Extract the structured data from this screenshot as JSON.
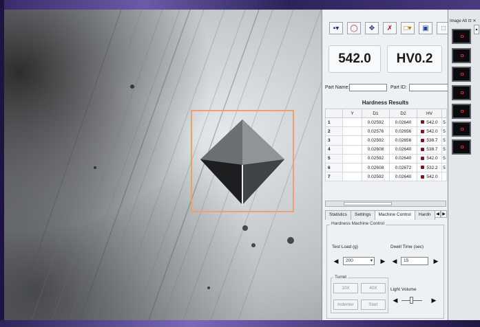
{
  "toolbar": {
    "icons": [
      "camera-icon",
      "target-icon",
      "crosshair-move-icon",
      "delete-icon",
      "open-folder-icon",
      "save-icon",
      "window-icon"
    ]
  },
  "readouts": {
    "hardness_value": "542.0",
    "scale": "HV0.2"
  },
  "part": {
    "name_label": "Part Name:",
    "id_label": "Part ID:",
    "name_value": "",
    "id_value": ""
  },
  "results": {
    "title": "Hardness Results",
    "columns": [
      "",
      "Y",
      "D1",
      "D2",
      "HV",
      ""
    ],
    "rows": [
      {
        "n": "1",
        "y": "",
        "d1": "0.02592",
        "d2": "0.02640",
        "hv": "542.0",
        "extra": "5"
      },
      {
        "n": "2",
        "y": "",
        "d1": "0.02576",
        "d2": "0.02656",
        "hv": "542.0",
        "extra": "5"
      },
      {
        "n": "3",
        "y": "",
        "d1": "0.02592",
        "d2": "0.02656",
        "hv": "538.7",
        "extra": "5"
      },
      {
        "n": "4",
        "y": "",
        "d1": "0.02608",
        "d2": "0.02640",
        "hv": "538.7",
        "extra": "5"
      },
      {
        "n": "5",
        "y": "",
        "d1": "0.02592",
        "d2": "0.02640",
        "hv": "542.0",
        "extra": "5"
      },
      {
        "n": "6",
        "y": "",
        "d1": "0.02608",
        "d2": "0.02672",
        "hv": "532.2",
        "extra": "5"
      },
      {
        "n": "7",
        "y": "",
        "d1": "0.02592",
        "d2": "0.02640",
        "hv": "542.0",
        "extra": ""
      }
    ]
  },
  "tabs": [
    "Statistics",
    "Settings",
    "Machine Control",
    "Hardn"
  ],
  "machine": {
    "group_title": "Hardness Machine Control",
    "test_load_label": "Test Load (g)",
    "test_load_value": "200",
    "dwell_label": "Dwell Time (sec)",
    "dwell_value": "15",
    "turret_label": "Turret",
    "btn_10x": "10X",
    "btn_40x": "40X",
    "btn_indenter": "Indenter",
    "btn_start": "Start",
    "light_label": "Light Volume"
  },
  "thumbnails": {
    "title": "Image Alt ⊡ ✕",
    "count": 6
  },
  "colors": {
    "roi_outline": "#f0a070",
    "marker": "#8a1020"
  }
}
